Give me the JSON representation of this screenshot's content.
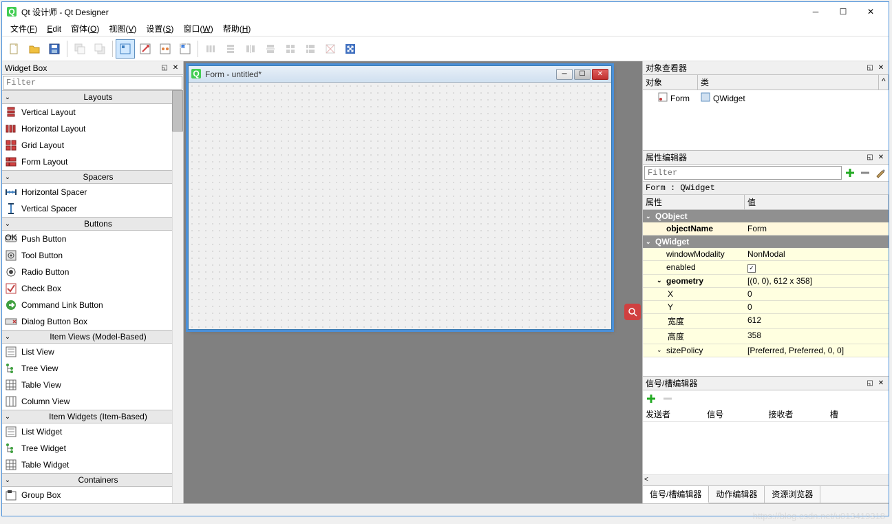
{
  "titlebar": {
    "title": "Qt 设计师 - Qt Designer"
  },
  "menubar": [
    {
      "label": "文件",
      "accel": "F"
    },
    {
      "label": "Edit",
      "accel": ""
    },
    {
      "label": "窗体",
      "accel": "O"
    },
    {
      "label": "视图",
      "accel": "V"
    },
    {
      "label": "设置",
      "accel": "S"
    },
    {
      "label": "窗口",
      "accel": "W"
    },
    {
      "label": "帮助",
      "accel": "H"
    }
  ],
  "widget_box": {
    "title": "Widget Box",
    "filter_placeholder": "Filter",
    "categories": [
      {
        "name": "Layouts",
        "items": [
          "Vertical Layout",
          "Horizontal Layout",
          "Grid Layout",
          "Form Layout"
        ]
      },
      {
        "name": "Spacers",
        "items": [
          "Horizontal Spacer",
          "Vertical Spacer"
        ]
      },
      {
        "name": "Buttons",
        "items": [
          "Push Button",
          "Tool Button",
          "Radio Button",
          "Check Box",
          "Command Link Button",
          "Dialog Button Box"
        ]
      },
      {
        "name": "Item Views (Model-Based)",
        "items": [
          "List View",
          "Tree View",
          "Table View",
          "Column View"
        ]
      },
      {
        "name": "Item Widgets (Item-Based)",
        "items": [
          "List Widget",
          "Tree Widget",
          "Table Widget"
        ]
      },
      {
        "name": "Containers",
        "items": [
          "Group Box"
        ]
      }
    ]
  },
  "form_window": {
    "title": "Form - untitled*"
  },
  "object_inspector": {
    "title": "对象查看器",
    "columns": [
      "对象",
      "类"
    ],
    "row": {
      "object": "Form",
      "class": "QWidget"
    }
  },
  "property_editor": {
    "title": "属性编辑器",
    "filter_placeholder": "Filter",
    "context": "Form : QWidget",
    "columns": [
      "属性",
      "值"
    ],
    "groups": [
      {
        "name": "QObject",
        "rows": [
          {
            "name": "objectName",
            "value": "Form",
            "bold": true
          }
        ]
      },
      {
        "name": "QWidget",
        "rows": [
          {
            "name": "windowModality",
            "value": "NonModal"
          },
          {
            "name": "enabled",
            "value": "checked",
            "type": "check"
          },
          {
            "name": "geometry",
            "value": "[(0, 0), 612 x 358]",
            "bold": true,
            "expand": true,
            "sub": [
              {
                "name": "X",
                "value": "0"
              },
              {
                "name": "Y",
                "value": "0"
              },
              {
                "name": "宽度",
                "value": "612"
              },
              {
                "name": "高度",
                "value": "358"
              }
            ]
          },
          {
            "name": "sizePolicy",
            "value": "[Preferred, Preferred, 0, 0]",
            "expand": true
          }
        ]
      }
    ]
  },
  "signal_editor": {
    "title": "信号/槽编辑器",
    "columns": [
      "发送者",
      "信号",
      "接收者",
      "槽"
    ]
  },
  "bottom_tabs": [
    "信号/槽编辑器",
    "动作编辑器",
    "资源浏览器"
  ],
  "watermark": "https://blog.csdn.net/u013419318"
}
